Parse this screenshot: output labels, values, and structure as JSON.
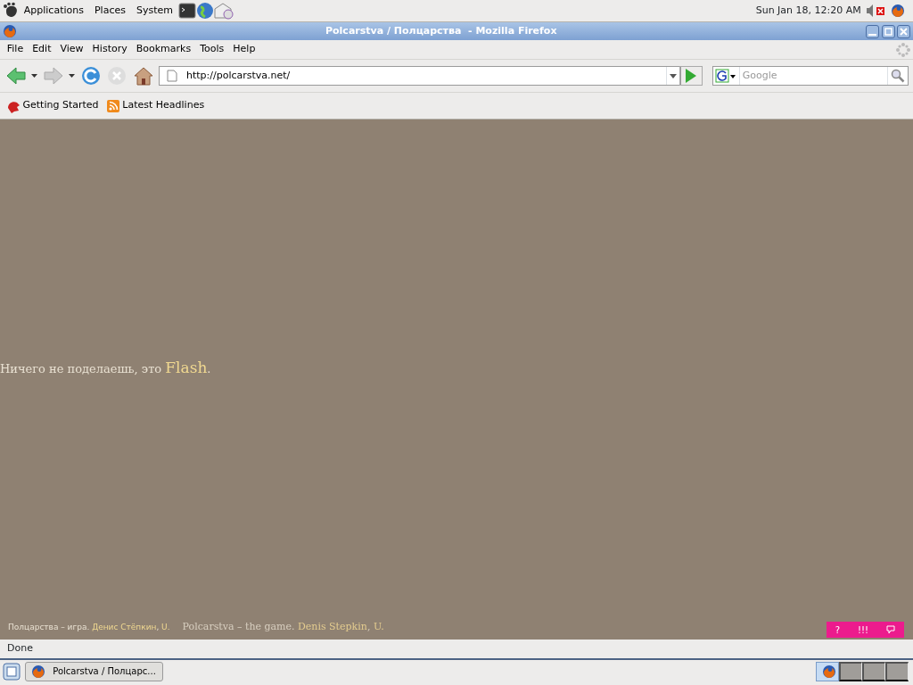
{
  "top_panel": {
    "menus": [
      "Applications",
      "Places",
      "System"
    ],
    "clock": "Sun Jan 18, 12:20 AM"
  },
  "window": {
    "title": "Polcarstva / Полцарства  - Mozilla Firefox"
  },
  "menu_bar": [
    "File",
    "Edit",
    "View",
    "History",
    "Bookmarks",
    "Tools",
    "Help"
  ],
  "toolbar": {
    "back_disabled": false,
    "forward_disabled": true,
    "stop_disabled": true,
    "url": "http://polcarstva.net/",
    "search_placeholder": "Google"
  },
  "bookmarks": [
    "Getting Started",
    "Latest Headlines"
  ],
  "content": {
    "message": "Ничего не поделаешь, это ",
    "flash_link": "Flash",
    "message_end": ".",
    "footer": [
      {
        "kind": "ru",
        "text": "Полцарства – игра. ",
        "author": "Денис Стёпкин",
        "sep": ", ",
        "initial": "U."
      },
      {
        "kind": "en",
        "text": "Polcarstva – the game. ",
        "author": "Denis Stepkin",
        "sep": ", ",
        "initial": "U."
      }
    ],
    "corner_buttons": [
      {
        "kind": "text",
        "label": "?"
      },
      {
        "kind": "text",
        "label": "!!!"
      },
      {
        "kind": "icon"
      }
    ]
  },
  "status_bar": "Done",
  "bottom_panel": {
    "task": "Polcarstva / Полцарс...",
    "workspaces": [
      {
        "selected": true
      },
      {
        "selected": false
      },
      {
        "selected": false
      },
      {
        "selected": false
      }
    ]
  }
}
